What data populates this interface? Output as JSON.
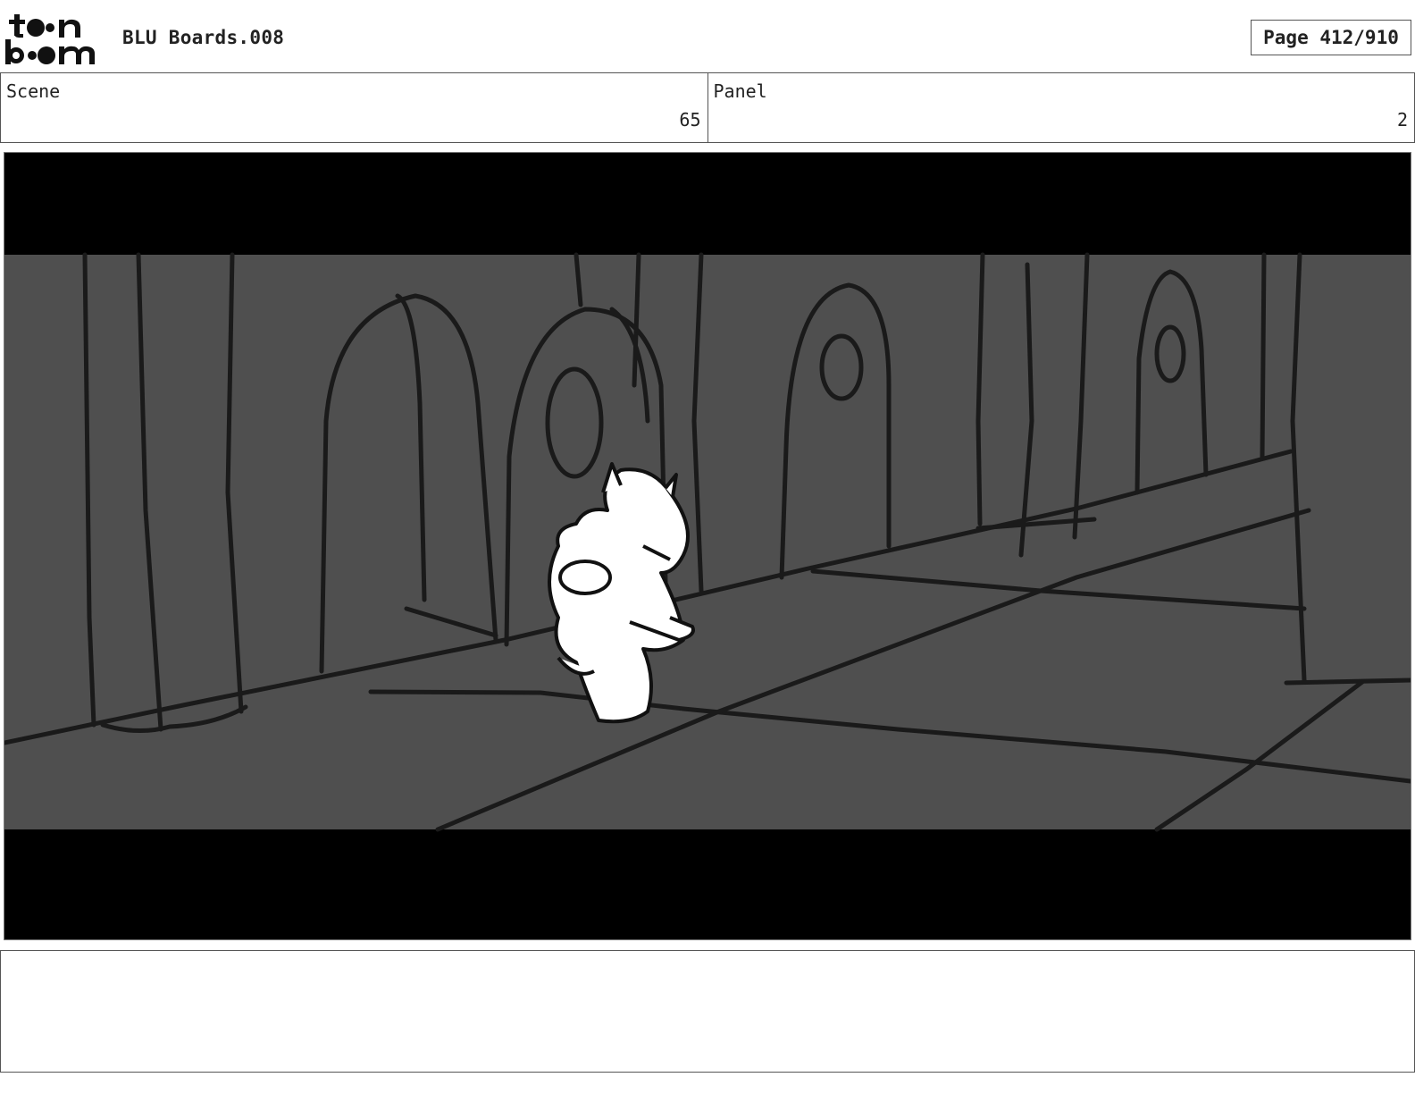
{
  "header": {
    "logo_text": "toon boom",
    "title": "BLU Boards.008",
    "page_label": "Page 412/910"
  },
  "info": {
    "scene_label": "Scene",
    "scene_value": "65",
    "panel_label": "Panel",
    "panel_value": "2"
  },
  "panel_image": {
    "description_icon": "storyboard-sketch-image",
    "background_color": "#4f4f4f",
    "letterbox_color": "#000000"
  },
  "caption": {
    "text": ""
  }
}
